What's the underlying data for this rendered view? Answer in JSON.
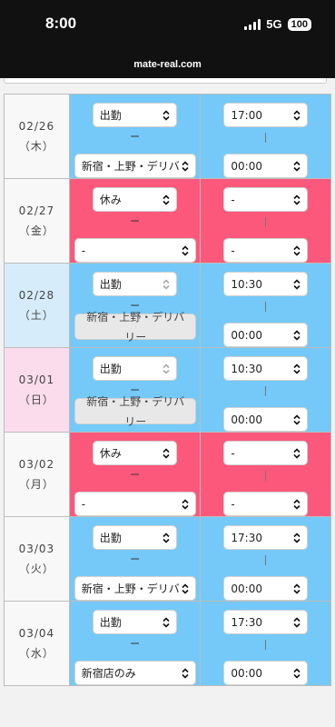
{
  "status_bar": {
    "time": "8:00",
    "network": "5G",
    "battery": "100"
  },
  "browser": {
    "url": "mate-real.com"
  },
  "separator": "ー",
  "rows": [
    {
      "date": "02/26",
      "weekday": "（木）",
      "status": "出勤",
      "area": "新宿・上野・デリバ",
      "start": "17:00",
      "end": "00:00",
      "disabled": false
    },
    {
      "date": "02/27",
      "weekday": "（金）",
      "status": "休み",
      "area": "-",
      "start": "-",
      "end": "-",
      "disabled": false
    },
    {
      "date": "02/28",
      "weekday": "（土）",
      "status": "出勤",
      "area": "新宿・上野・デリバリー",
      "start": "10:30",
      "end": "00:00",
      "disabled": true
    },
    {
      "date": "03/01",
      "weekday": "（日）",
      "status": "出勤",
      "area": "新宿・上野・デリバリー",
      "start": "10:30",
      "end": "00:00",
      "disabled": true
    },
    {
      "date": "03/02",
      "weekday": "（月）",
      "status": "休み",
      "area": "-",
      "start": "-",
      "end": "-",
      "disabled": false
    },
    {
      "date": "03/03",
      "weekday": "（火）",
      "status": "出勤",
      "area": "新宿・上野・デリバ",
      "start": "17:30",
      "end": "00:00",
      "disabled": false
    },
    {
      "date": "03/04",
      "weekday": "（水）",
      "status": "出勤",
      "area": "新宿店のみ",
      "start": "17:30",
      "end": "00:00",
      "disabled": false
    }
  ],
  "colors": {
    "work": "#74c9f8",
    "off": "#fb587c",
    "saturday": "#d6ecfa",
    "sunday": "#fadcec"
  }
}
